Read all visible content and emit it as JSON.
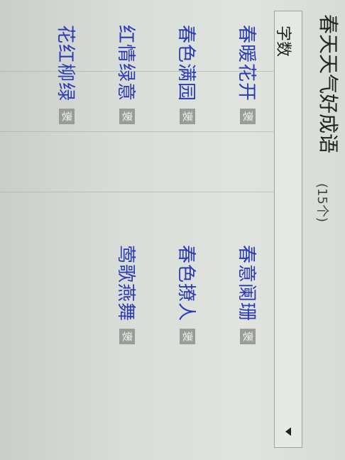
{
  "page": {
    "title": "春天天气好成语",
    "count_label": "(15个)"
  },
  "filter": {
    "label": "字数"
  },
  "idioms": [
    {
      "text": "春暖花开",
      "badge": "褒"
    },
    {
      "text": "春意阑珊",
      "badge": "褒"
    },
    {
      "text": "春色满园",
      "badge": "褒"
    },
    {
      "text": "春色撩人",
      "badge": "褒"
    },
    {
      "text": "红情绿意",
      "badge": "褒"
    },
    {
      "text": "莺歌燕舞",
      "badge": "褒"
    },
    {
      "text": "花红柳绿",
      "badge": "褒"
    }
  ]
}
